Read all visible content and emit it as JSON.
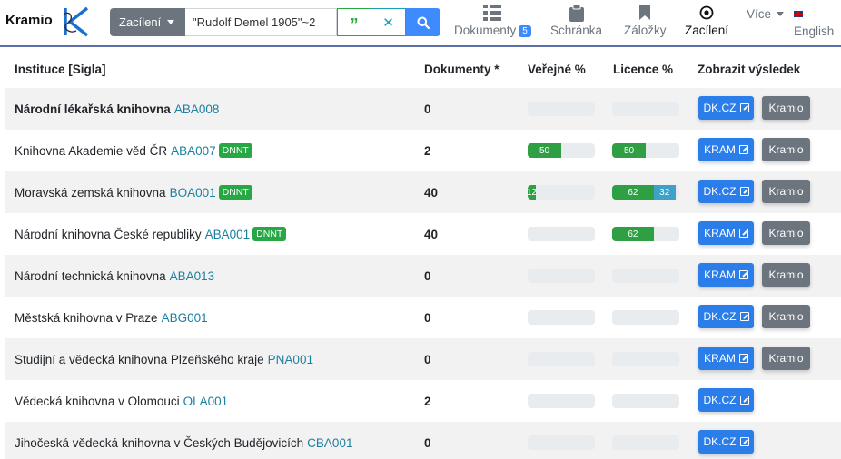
{
  "header": {
    "brand": "Kramio",
    "search": {
      "select_label": "Zacílení",
      "query": "\"Rudolf Demel 1905\"~2"
    },
    "nav": {
      "documents": {
        "label": "Dokumenty",
        "count": "5"
      },
      "clipboard": {
        "label": "Schránka"
      },
      "bookmarks": {
        "label": "Záložky"
      },
      "targeting": {
        "label": "Zacílení"
      }
    },
    "more": "Více",
    "language": "English"
  },
  "table": {
    "headers": {
      "institution": "Instituce [Sigla]",
      "documents": "Dokumenty *",
      "public": "Veřejné %",
      "license": "Licence %",
      "show": "Zobrazit výsledek"
    },
    "rows": [
      {
        "name": "Národní lékařská knihovna",
        "sigla": "ABA008",
        "bold": true,
        "dnnt": "",
        "docs": "0",
        "public": [],
        "license": [],
        "primary": "DK.CZ",
        "kramio": "Kramio"
      },
      {
        "name": "Knihovna Akademie věd ČR",
        "sigla": "ABA007",
        "bold": false,
        "dnnt": "DNNT",
        "docs": "2",
        "public": [
          {
            "value": 50,
            "label": "50",
            "color": "green"
          }
        ],
        "license": [
          {
            "value": 50,
            "label": "50",
            "color": "green"
          }
        ],
        "primary": "KRAM",
        "kramio": "Kramio"
      },
      {
        "name": "Moravská zemská knihovna",
        "sigla": "BOA001",
        "bold": false,
        "dnnt": "DNNT",
        "docs": "40",
        "public": [
          {
            "value": 12,
            "label": "12",
            "color": "green"
          }
        ],
        "license": [
          {
            "value": 62,
            "label": "62",
            "color": "green"
          },
          {
            "value": 32,
            "label": "32",
            "color": "teal"
          }
        ],
        "primary": "DK.CZ",
        "kramio": "Kramio"
      },
      {
        "name": "Národní knihovna České republiky",
        "sigla": "ABA001",
        "bold": false,
        "dnnt": "DNNT",
        "docs": "40",
        "public": [],
        "license": [
          {
            "value": 62,
            "label": "62",
            "color": "green"
          }
        ],
        "primary": "KRAM",
        "kramio": "Kramio"
      },
      {
        "name": "Národní technická knihovna",
        "sigla": "ABA013",
        "bold": false,
        "dnnt": "",
        "docs": "0",
        "public": [],
        "license": [],
        "primary": "KRAM",
        "kramio": "Kramio"
      },
      {
        "name": "Městská knihovna v Praze",
        "sigla": "ABG001",
        "bold": false,
        "dnnt": "",
        "docs": "0",
        "public": [],
        "license": [],
        "primary": "DK.CZ",
        "kramio": "Kramio"
      },
      {
        "name": "Studijní a vědecká knihovna Plzeňského kraje",
        "sigla": "PNA001",
        "bold": false,
        "dnnt": "",
        "docs": "0",
        "public": [],
        "license": [],
        "primary": "KRAM",
        "kramio": "Kramio"
      },
      {
        "name": "Vědecká knihovna v Olomouci",
        "sigla": "OLA001",
        "bold": false,
        "dnnt": "",
        "docs": "2",
        "public": [],
        "license": [],
        "primary": "DK.CZ",
        "kramio": ""
      },
      {
        "name": "Jihočeská vědecká knihovna v Českých Budějovicích",
        "sigla": "CBA001",
        "bold": false,
        "dnnt": "",
        "docs": "0",
        "public": [],
        "license": [],
        "primary": "DK.CZ",
        "kramio": ""
      }
    ]
  }
}
